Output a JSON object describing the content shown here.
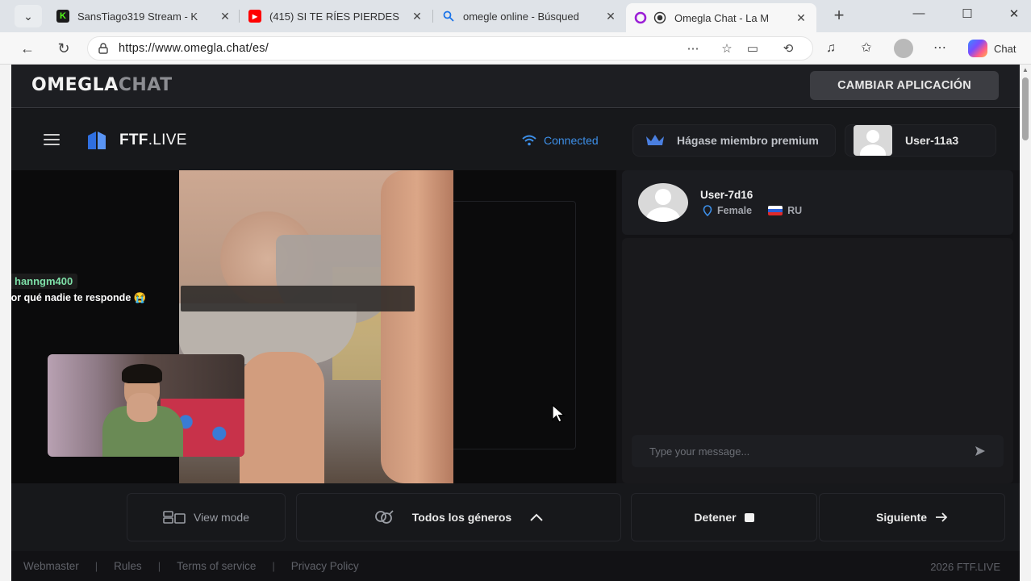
{
  "browser": {
    "tabs": [
      {
        "title": "SansTiago319 Stream - K",
        "favicon": "kick-icon",
        "color": "#53fc18"
      },
      {
        "title": "(415) SI TE RÍES PIERDES",
        "favicon": "youtube-icon",
        "color": "#ff0000"
      },
      {
        "title": "omegle online - Búsqued",
        "favicon": "search-icon",
        "color": "#1a73e8"
      },
      {
        "title": "Omegla Chat - La M",
        "favicon": "omegla-icon",
        "color": "#9b1fd6",
        "active": true
      }
    ],
    "url": "https://www.omegla.chat/es/",
    "copilot_label": "Chat"
  },
  "site": {
    "logo_part1": "OMEGLA",
    "logo_part2": "CHAT",
    "switch_app_label": "CAMBIAR APLICACIÓN"
  },
  "app": {
    "brand_bold": "FTF",
    "brand_thin": ".LIVE",
    "status": "Connected",
    "premium_label": "Hágase miembro premium",
    "username": "User-11a3"
  },
  "stream_overlay": {
    "username": "hanngm400",
    "message": "por qué nadie te responde 😭"
  },
  "partner": {
    "name": "User-7d16",
    "gender": "Female",
    "country": "RU"
  },
  "chat": {
    "placeholder": "Type your message..."
  },
  "controls": {
    "view_mode": "View mode",
    "gender_filter": "Todos los géneros",
    "stop": "Detener",
    "next": "Siguiente"
  },
  "footer": {
    "links": [
      "Webmaster",
      "Rules",
      "Terms of service",
      "Privacy Policy"
    ],
    "copyright": "2026 FTF.LIVE"
  },
  "colors": {
    "accent_blue": "#3d8fe8",
    "page_bg": "#131316"
  }
}
